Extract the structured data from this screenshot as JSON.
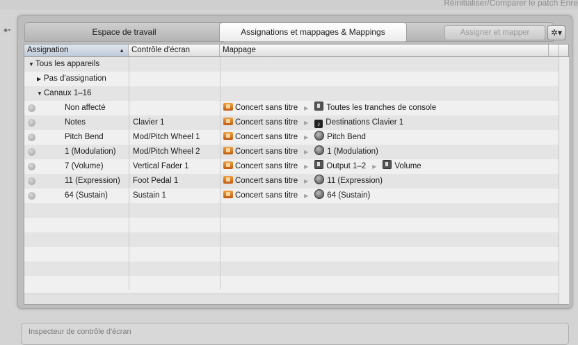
{
  "top_strip": {
    "text": "Réinitialiser/Comparer le patch   Enre"
  },
  "tabs": [
    {
      "label": "Espace de travail"
    },
    {
      "label": "Assignations et mappages & Mappings"
    }
  ],
  "toolbar": {
    "assign_label": "Assigner et mapper",
    "gear_glyph": "✲▾"
  },
  "table": {
    "headers": {
      "assignation": "Assignation",
      "controle": "Contrôle d'écran",
      "mappage": "Mappage"
    },
    "rows": [
      {
        "name": "Tous les appareils",
        "control": "",
        "map_source": "",
        "map_target": "",
        "map_extra": ""
      },
      {
        "name": "Pas d'assignation",
        "control": "",
        "map_source": "",
        "map_target": "",
        "map_extra": ""
      },
      {
        "name": "Canaux 1–16",
        "control": "",
        "map_source": "",
        "map_target": "",
        "map_extra": ""
      },
      {
        "name": "Non affecté",
        "control": "",
        "map_source": "Concert sans titre",
        "map_target": "Toutes les tranches de console",
        "map_extra": ""
      },
      {
        "name": "Notes",
        "control": "Clavier 1",
        "map_source": "Concert sans titre",
        "map_target": "Destinations Clavier 1",
        "map_extra": ""
      },
      {
        "name": "Pitch Bend",
        "control": "Mod/Pitch Wheel 1",
        "map_source": "Concert sans titre",
        "map_target": "Pitch Bend",
        "map_extra": ""
      },
      {
        "name": "1 (Modulation)",
        "control": "Mod/Pitch Wheel 2",
        "map_source": "Concert sans titre",
        "map_target": "1 (Modulation)",
        "map_extra": ""
      },
      {
        "name": "7 (Volume)",
        "control": "Vertical Fader 1",
        "map_source": "Concert sans titre",
        "map_target": "Output 1–2",
        "map_extra": "Volume"
      },
      {
        "name": "11 (Expression)",
        "control": "Foot Pedal 1",
        "map_source": "Concert sans titre",
        "map_target": "11 (Expression)",
        "map_extra": ""
      },
      {
        "name": "64 (Sustain)",
        "control": "Sustain 1",
        "map_source": "Concert sans titre",
        "map_target": "64 (Sustain)",
        "map_extra": ""
      }
    ]
  },
  "bottom_panel": {
    "text": "Inspecteur de contrôle d'écran"
  }
}
